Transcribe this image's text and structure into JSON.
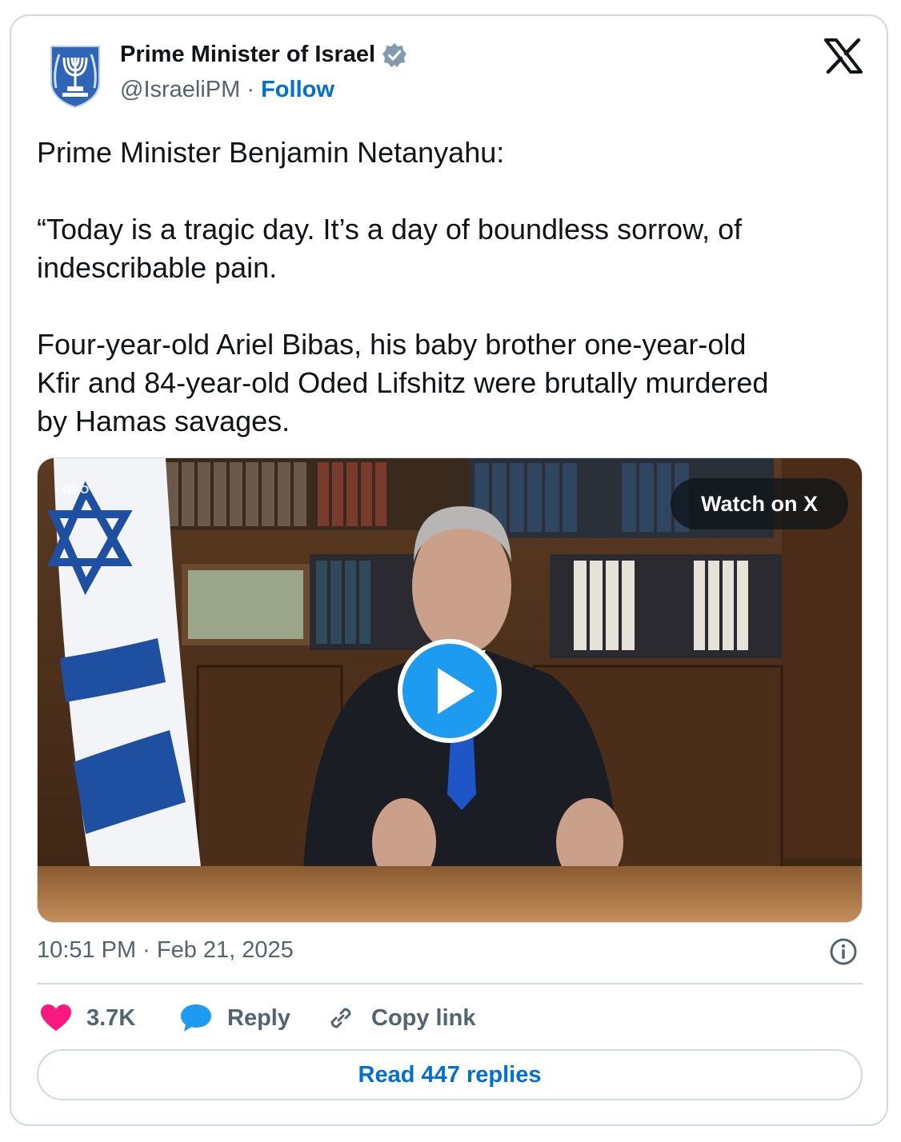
{
  "account": {
    "name": "Prime Minister of Israel",
    "handle": "@IsraeliPM",
    "separator": " · ",
    "follow_label": "Follow"
  },
  "tweet": {
    "text": "Prime Minister Benjamin Netanyahu:\n\n“Today is a tragic day. It’s a day of boundless sorrow, of\nindescribable pain.\n\nFour-year-old Ariel Bibas, his baby brother one-year-old\nKfir and 84-year-old Oded Lifshitz were brutally murdered\nby Hamas savages.",
    "timestamp": "10:51 PM · Feb 21, 2025"
  },
  "media": {
    "watch_label": "Watch on X",
    "watermark": "GPO"
  },
  "actions": {
    "likes": "3.7K",
    "reply_label": "Reply",
    "copy_label": "Copy link"
  },
  "footer": {
    "read_replies_label": "Read 447 replies"
  },
  "colors": {
    "link_blue": "#006fd6",
    "like_pink": "#f91880",
    "reply_blue": "#1d9bf0",
    "muted_text": "#536471",
    "border": "#cfd9de"
  },
  "icons": {
    "avatar": "israel-emblem-icon",
    "verified": "verified-badge-icon",
    "brand": "x-logo-icon",
    "play": "play-icon",
    "info": "info-icon",
    "like": "heart-icon",
    "reply": "speech-bubble-icon",
    "copy": "link-icon"
  }
}
